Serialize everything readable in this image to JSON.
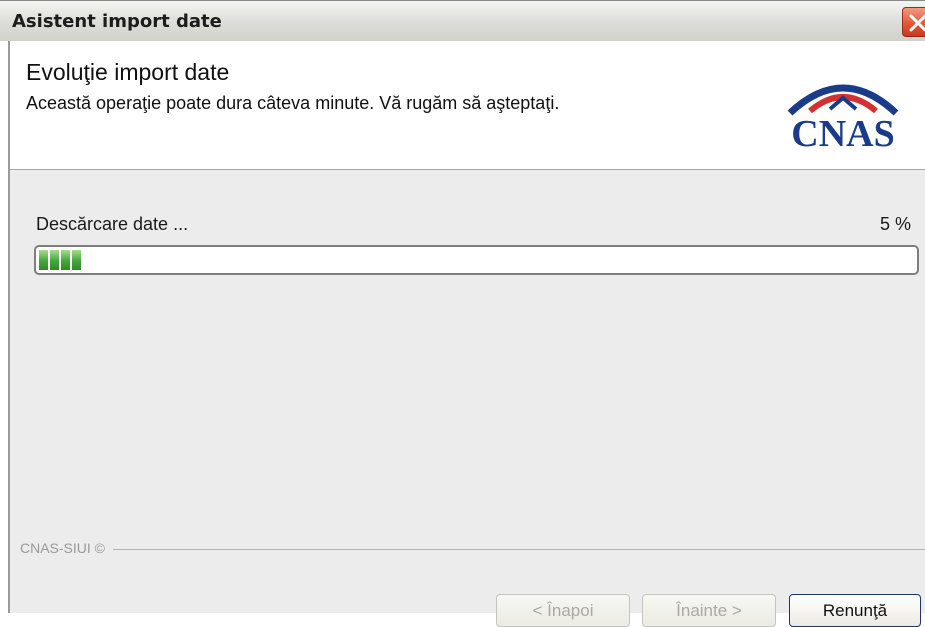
{
  "window": {
    "title": "Asistent import date"
  },
  "header": {
    "title": "Evoluţie import date",
    "subtitle": "Această operaţie poate dura câteva minute. Vă rugăm să aşteptaţi.",
    "logo_text": "CNAS"
  },
  "progress": {
    "label": "Descărcare date ...",
    "percent_text": "5 %",
    "value": 0.05
  },
  "footer": {
    "brand": "CNAS-SIUI ©"
  },
  "buttons": {
    "back": "< Înapoi",
    "next": "Înainte >",
    "cancel": "Renunţă"
  },
  "colors": {
    "progress_fill": "#43a73b",
    "close_button": "#e0593a",
    "logo_blue": "#1a3a8a",
    "logo_red": "#d62f2f"
  }
}
